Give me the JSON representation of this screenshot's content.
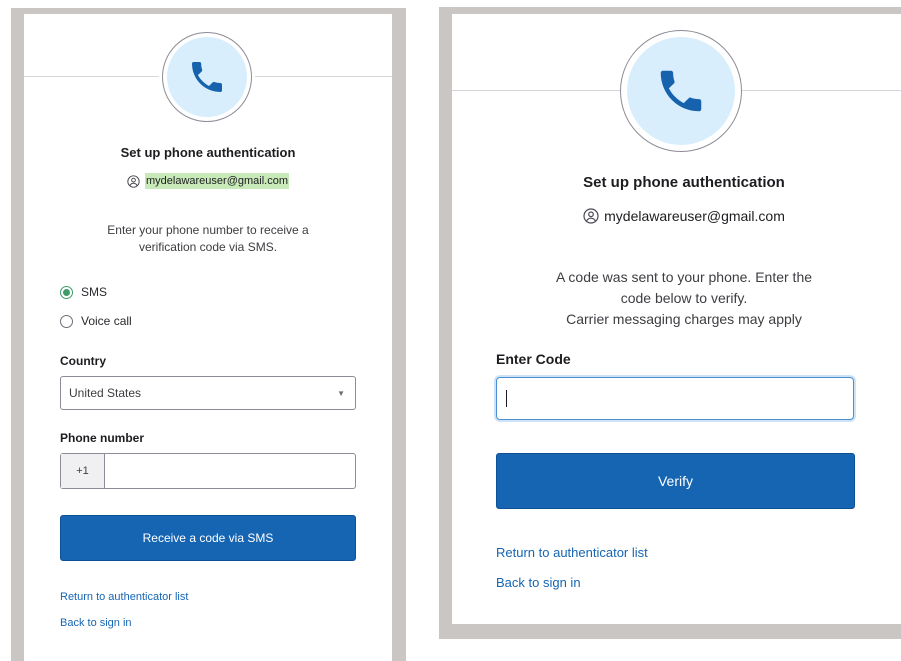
{
  "left_panel": {
    "title": "Set up phone authentication",
    "user_email": "mydelawareuser@gmail.com",
    "instruction_line1": "Enter your phone number to receive a",
    "instruction_line2": "verification code via SMS.",
    "options": [
      {
        "label": "SMS",
        "checked": true
      },
      {
        "label": "Voice call",
        "checked": false
      }
    ],
    "country_label": "Country",
    "country_value": "United States",
    "phone_label": "Phone number",
    "phone_prefix": "+1",
    "phone_value": "",
    "submit_label": "Receive a code via SMS",
    "return_link": "Return to authenticator list",
    "back_link": "Back to sign in"
  },
  "right_panel": {
    "title": "Set up phone authentication",
    "user_email": "mydelawareuser@gmail.com",
    "message_line1": "A code was sent to your phone.  Enter the",
    "message_line2": "code below to verify.",
    "message_line3": "Carrier messaging charges may apply",
    "code_label": "Enter Code",
    "code_value": "",
    "submit_label": "Verify",
    "return_link": "Return to authenticator list",
    "back_link": "Back to sign in"
  },
  "colors": {
    "primary_button": "#1665b3",
    "link": "#1665b3",
    "icon_bg": "#d8eefc",
    "icon": "#1662ad",
    "highlight": "#c8eab8",
    "frame": "#c9c6c3"
  },
  "icons": {
    "badge": "phone-icon",
    "user": "user-icon",
    "dropdown": "chevron-down-icon"
  }
}
